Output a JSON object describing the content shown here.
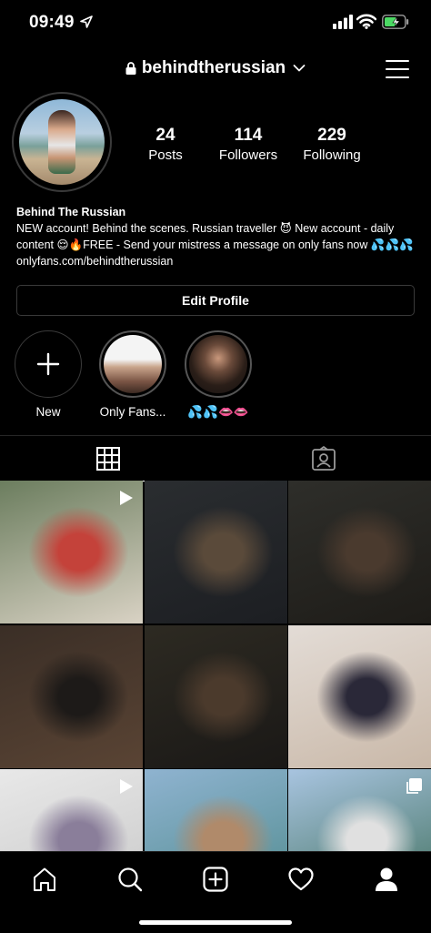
{
  "status_bar": {
    "time": "09:49"
  },
  "header": {
    "username": "behindtherussian"
  },
  "profile": {
    "stats": [
      {
        "value": "24",
        "label": "Posts"
      },
      {
        "value": "114",
        "label": "Followers"
      },
      {
        "value": "229",
        "label": "Following"
      }
    ],
    "name": "Behind The Russian",
    "bio": "NEW account! Behind the scenes. Russian traveller 😈 New account - daily content 😌🔥FREE - Send your mistress a message on only fans now 💦💦💦",
    "link": "onlyfans.com/behindtherussian",
    "edit_button": "Edit Profile"
  },
  "highlights": [
    {
      "label": "New"
    },
    {
      "label": "Only Fans..."
    },
    {
      "label": "💦💦👄👄"
    }
  ],
  "grid": {
    "posts": [
      {
        "type": "video",
        "colors": [
          "#6b7d5e",
          "#c4423a",
          "#d9d2c4"
        ]
      },
      {
        "type": "photo",
        "colors": [
          "#2a2d30",
          "#5a4a3a",
          "#1c1e22"
        ]
      },
      {
        "type": "photo",
        "colors": [
          "#2e2e2a",
          "#4a3a2e",
          "#1e1c18"
        ]
      },
      {
        "type": "photo",
        "colors": [
          "#3a2e26",
          "#1d1a18",
          "#5a4434"
        ]
      },
      {
        "type": "photo",
        "colors": [
          "#2d2a22",
          "#4b3a2c",
          "#1a1816"
        ]
      },
      {
        "type": "photo",
        "colors": [
          "#e3dcd6",
          "#2a2838",
          "#c9b8a8"
        ]
      },
      {
        "type": "video",
        "colors": [
          "#e8e8e8",
          "#8a7e9a",
          "#c8c8c8"
        ]
      },
      {
        "type": "photo",
        "colors": [
          "#8fb3d0",
          "#b08a6a",
          "#4e8a8c"
        ]
      },
      {
        "type": "carousel",
        "colors": [
          "#a8c4e0",
          "#e0e0e0",
          "#3e6e5a"
        ]
      }
    ]
  },
  "icons": {
    "status": [
      "location-arrow-icon",
      "signal-icon",
      "wifi-icon",
      "battery-icon"
    ],
    "nav": [
      "home-icon",
      "search-icon",
      "new-post-icon",
      "activity-heart-icon",
      "profile-icon"
    ]
  }
}
